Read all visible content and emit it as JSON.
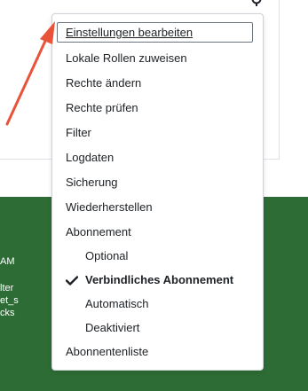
{
  "background": {
    "footer_lines": [
      "AM",
      "lter",
      "et_s",
      "cks"
    ]
  },
  "menu": {
    "items": [
      {
        "label": "Einstellungen bearbeiten"
      },
      {
        "label": "Lokale Rollen zuweisen"
      },
      {
        "label": "Rechte ändern"
      },
      {
        "label": "Rechte prüfen"
      },
      {
        "label": "Filter"
      },
      {
        "label": "Logdaten"
      },
      {
        "label": "Sicherung"
      },
      {
        "label": "Wiederherstellen"
      },
      {
        "label": "Abonnement"
      },
      {
        "label": "Optional"
      },
      {
        "label": "Verbindliches Abonnement",
        "selected": true
      },
      {
        "label": "Automatisch"
      },
      {
        "label": "Deaktiviert"
      },
      {
        "label": "Abonnentenliste"
      }
    ]
  },
  "colors": {
    "arrow": "#e8533a",
    "footer": "#2d6d35"
  },
  "icons": {
    "gear": "gear-icon",
    "check": "checkmark-icon",
    "arrow": "annotation-arrow"
  }
}
